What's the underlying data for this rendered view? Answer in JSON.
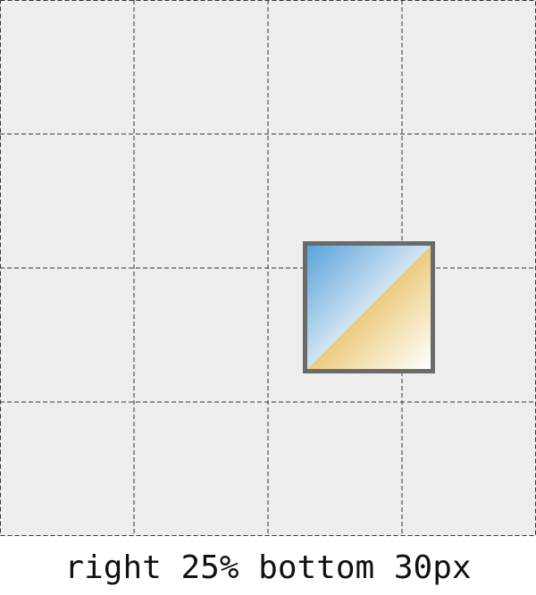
{
  "caption": "right 25% bottom 30px",
  "colors": {
    "stage_background": "#eeeeee",
    "grid_line": "#333333",
    "box_border": "#6b6b6b",
    "blue_gradient_start": "#5ba3d9",
    "gold_gradient_start": "#e4b84a"
  },
  "diagram": {
    "grid_columns": 4,
    "grid_rows": 4,
    "grid_line_style": "dashed"
  }
}
